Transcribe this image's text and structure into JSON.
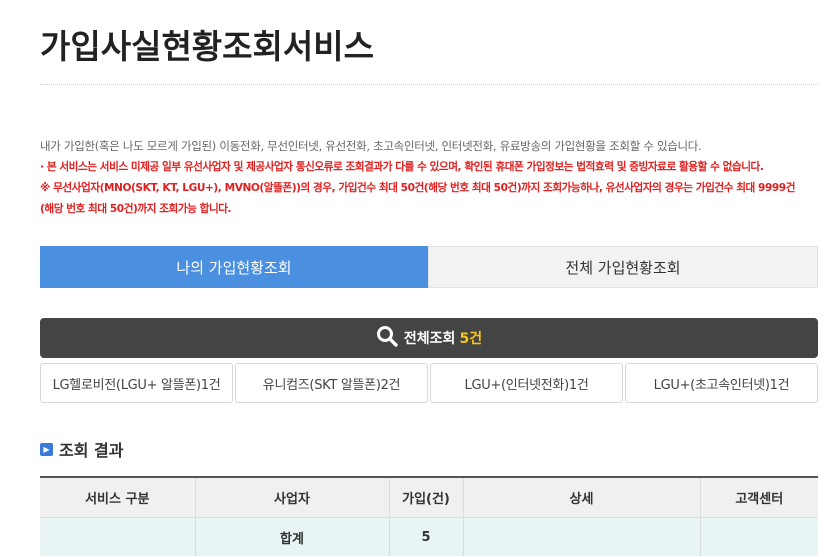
{
  "page": {
    "title": "가입사실현황조회서비스"
  },
  "description": {
    "main": "내가 가입한(혹은 나도 모르게 가입된) 이동전화, 무선인터넷, 유선전화, 초고속인터넷, 인터넷전화, 유료방송의 가입현황을 조회할 수 있습니다.",
    "warn1": "· 본 서비스는 서비스 미제공 일부 유선사업자 및 제공사업자 통신오류로 조회결과가 다를 수 있으며, 확인된 휴대폰 가입정보는 법적효력 및 증빙자료로 활용할 수 없습니다.",
    "warn2": "※ 무선사업자(MNO(SKT, KT, LGU+), MVNO(알뜰폰))의 경우, 가입건수 최대 50건(해당 번호 최대 50건)까지 조회가능하나, 유선사업자의 경우는 가입건수 최대 9999건",
    "warn3": "(해당 번호 최대 50건)까지 조회가능 합니다."
  },
  "tabs": [
    {
      "label": "나의 가입현황조회",
      "active": true
    },
    {
      "label": "전체 가입현황조회",
      "active": false
    }
  ],
  "search": {
    "label": "전체조회",
    "count": "5건",
    "icon": "search-icon"
  },
  "carriers": [
    {
      "label": "LG헬로비전(LGU+ 알뜰폰)1건"
    },
    {
      "label": "유니컴즈(SKT 알뜰폰)2건"
    },
    {
      "label": "LGU+(인터넷전화)1건"
    },
    {
      "label": "LGU+(초고속인터넷)1건"
    }
  ],
  "results": {
    "section_title": "조회 결과",
    "section_icon": "chevron-right-icon",
    "columns": [
      "서비스 구분",
      "사업자",
      "가입(건)",
      "상세",
      "고객센터"
    ],
    "total_row": {
      "label": "합계",
      "count": "5"
    }
  },
  "colors": {
    "accent": "#4a8fe0",
    "search_bar": "#444444",
    "count_highlight": "#f5c518",
    "warning": "#e02020",
    "total_row_bg": "#e9f5f5"
  }
}
